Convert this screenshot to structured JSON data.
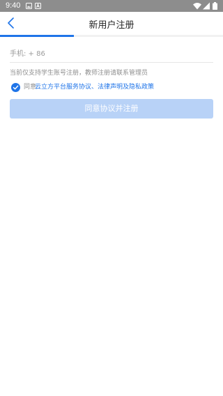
{
  "status_bar": {
    "time": "9:40",
    "icons": [
      "gallery-icon",
      "app-notification-icon",
      "wifi-icon",
      "signal-icon",
      "battery-icon"
    ]
  },
  "header": {
    "title": "新用户注册",
    "back_icon": "chevron-left-icon"
  },
  "progress": {
    "fraction": 0.33,
    "color": "#1f74e8"
  },
  "form": {
    "phone_label": "手机: + 86",
    "phone_value": "",
    "hint": "当前仅支持学生账号注册，教师注册请联系管理员",
    "agreement": {
      "checked": true,
      "prefix": "同意",
      "link_text": "云立方平台服务协议、法律声明及隐私政策"
    },
    "submit_label": "同意协议并注册"
  },
  "colors": {
    "accent": "#1f74e8",
    "button_disabled": "#b8d2f7",
    "status_bar": "#8d8d8d"
  }
}
